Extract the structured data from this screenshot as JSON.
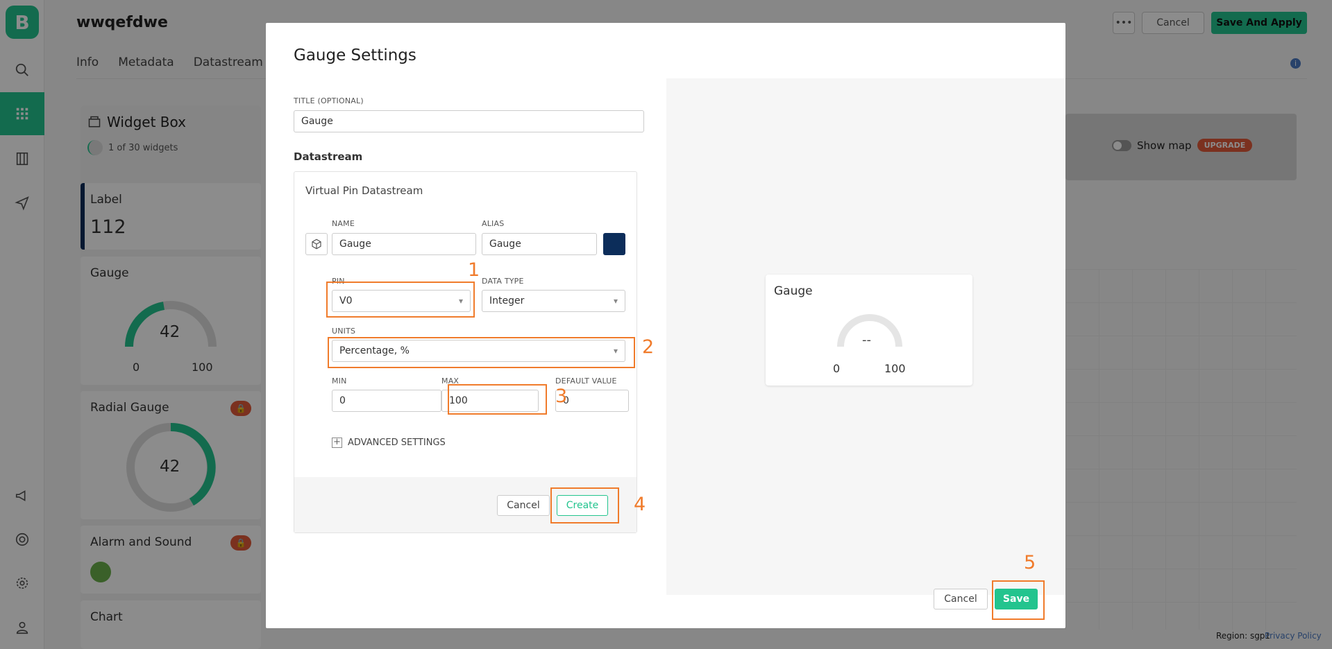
{
  "app": {
    "logo_letter": "B",
    "template_name": "wwqefdwe",
    "tabs": [
      "Info",
      "Metadata",
      "Datastream"
    ],
    "more_label": "•••",
    "cancel_label": "Cancel",
    "apply_label": "Save And Apply",
    "info_icon": "i",
    "rail_icons": [
      "search-icon",
      "grid-icon",
      "building-icon",
      "send-icon",
      "megaphone-icon",
      "lifebuoy-icon",
      "gear-icon",
      "user-icon"
    ]
  },
  "widget_box": {
    "title": "Widget Box",
    "count": "1 of 30 widgets",
    "widgets": [
      {
        "name": "Label",
        "value": "112"
      },
      {
        "name": "Gauge",
        "value": "42",
        "min": "0",
        "max": "100"
      },
      {
        "name": "Radial Gauge",
        "value": "42",
        "badge": "🔒"
      },
      {
        "name": "Alarm and Sound",
        "badge": "🔒"
      },
      {
        "name": "Chart"
      }
    ]
  },
  "map": {
    "show_map": "Show map",
    "upgrade": "UPGRADE"
  },
  "footer": {
    "region": "Region: sgp1",
    "privacy": "Privacy Policy"
  },
  "modal": {
    "title": "Gauge Settings",
    "title_field_label": "TITLE (OPTIONAL)",
    "title_field_value": "Gauge",
    "datastream_heading": "Datastream",
    "card_title": "Virtual Pin Datastream",
    "name_label": "NAME",
    "name_value": "Gauge",
    "alias_label": "ALIAS",
    "alias_value": "Gauge",
    "color_swatch": "#0c2d5a",
    "pin_label": "PIN",
    "pin_value": "V0",
    "datatype_label": "DATA TYPE",
    "datatype_value": "Integer",
    "units_label": "UNITS",
    "units_value": "Percentage, %",
    "min_label": "MIN",
    "min_value": "0",
    "max_label": "MAX",
    "max_value": "100",
    "default_label": "DEFAULT VALUE",
    "default_value": "0",
    "advanced_label": "ADVANCED SETTINGS",
    "card_cancel": "Cancel",
    "card_create": "Create",
    "cancel": "Cancel",
    "save": "Save"
  },
  "preview": {
    "title": "Gauge",
    "value": "--",
    "min": "0",
    "max": "100"
  },
  "annotations": [
    "1",
    "2",
    "3",
    "4",
    "5"
  ],
  "colors": {
    "accent": "#23c48e",
    "annotation": "#f07b2b",
    "lock_badge": "#e05a3a"
  }
}
